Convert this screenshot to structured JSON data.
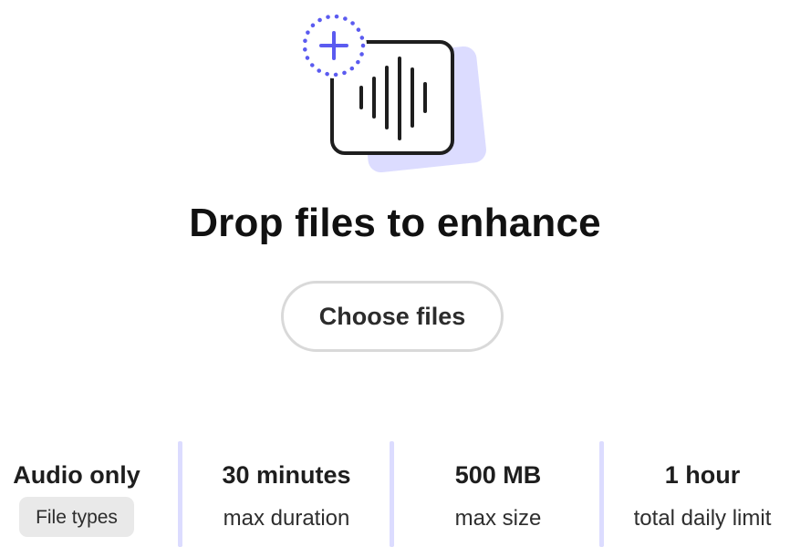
{
  "dropzone": {
    "title": "Drop files to enhance",
    "choose_button_label": "Choose files",
    "accent_color": "#5b5bf0",
    "shadow_color": "#dcdcff"
  },
  "limits": [
    {
      "value": "Audio only",
      "caption": "File types",
      "caption_is_button": true
    },
    {
      "value": "30 minutes",
      "caption": "max duration"
    },
    {
      "value": "500 MB",
      "caption": "max size"
    },
    {
      "value": "1 hour",
      "caption": "total daily limit"
    }
  ]
}
